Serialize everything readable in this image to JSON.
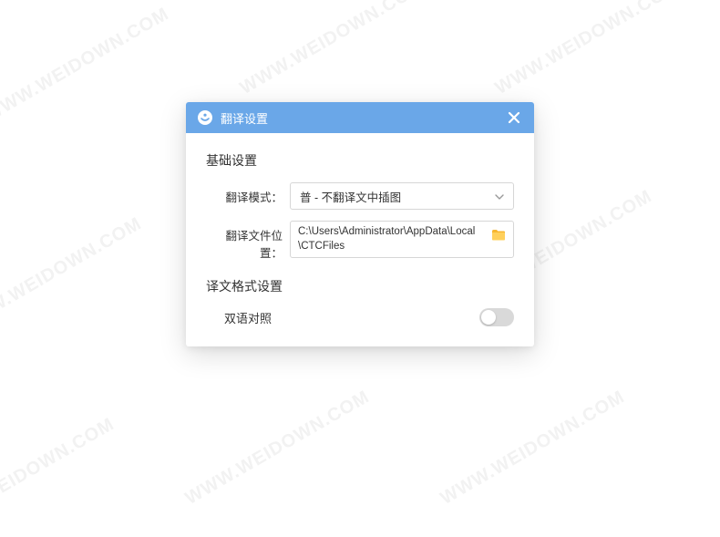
{
  "watermark_text": "WWW.WEIDOWN.COM",
  "dialog": {
    "title": "翻译设置",
    "sections": {
      "basic_title": "基础设置",
      "mode_label": "翻译模式：",
      "mode_value": "普 - 不翻译文中插图",
      "path_label": "翻译文件位置：",
      "path_value": "C:\\Users\\Administrator\\AppData\\Local\\CTCFiles",
      "format_title": "译文格式设置",
      "bilingual_label": "双语对照"
    }
  },
  "colors": {
    "titlebar_bg": "#6aa7e8",
    "folder_fill": "#f7b731"
  }
}
